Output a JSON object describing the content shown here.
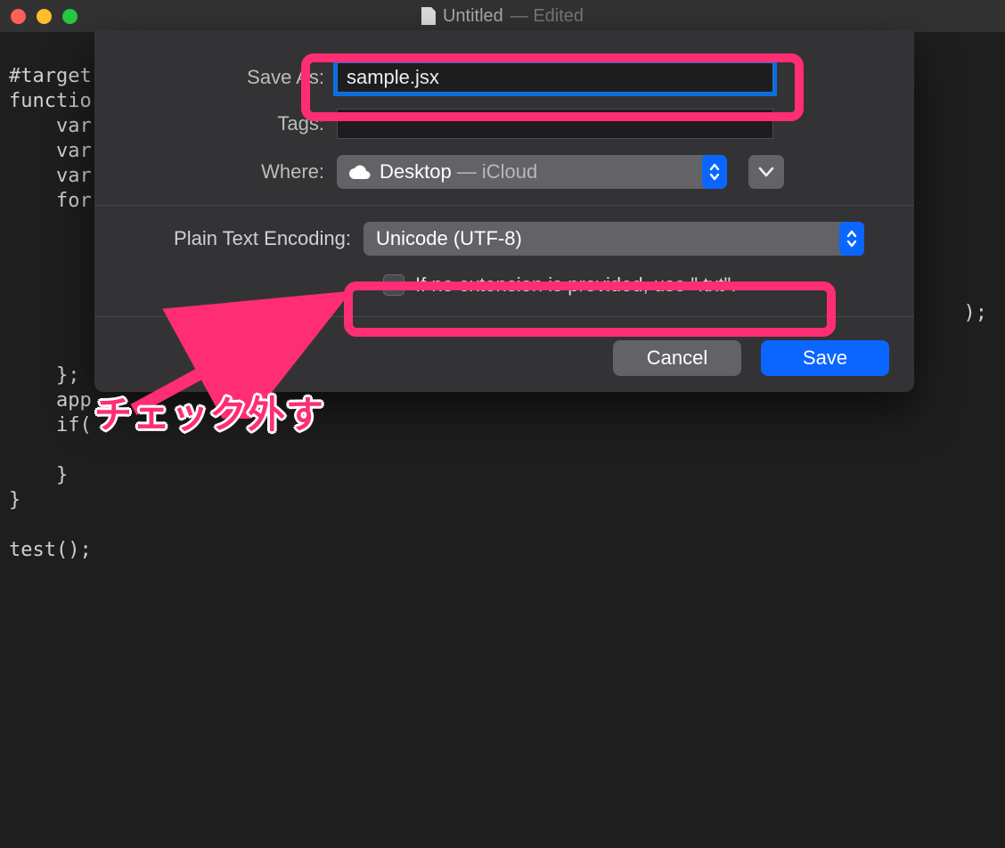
{
  "window": {
    "title": "Untitled",
    "status": "— Edited"
  },
  "editor": {
    "lines": [
      "#target",
      "functio",
      "    var",
      "    var",
      "    var",
      "    for",
      "",
      "",
      "",
      "",
      "",
      "",
      "    };",
      "    app",
      "    if(",
      "",
      "    }",
      "}",
      "",
      "test();",
      ""
    ],
    "trailing": ");"
  },
  "dialog": {
    "save_as_label": "Save As:",
    "filename": "sample.jsx",
    "tags_label": "Tags:",
    "tags_value": "",
    "where_label": "Where:",
    "where_value": "Desktop",
    "where_sub": "— iCloud",
    "encoding_label": "Plain Text Encoding:",
    "encoding_value": "Unicode (UTF-8)",
    "checkbox_label": "If no extension is provided, use \".txt\".",
    "checkbox_checked": false,
    "cancel_label": "Cancel",
    "save_label": "Save"
  },
  "annotation": {
    "text": "チェック外す"
  }
}
